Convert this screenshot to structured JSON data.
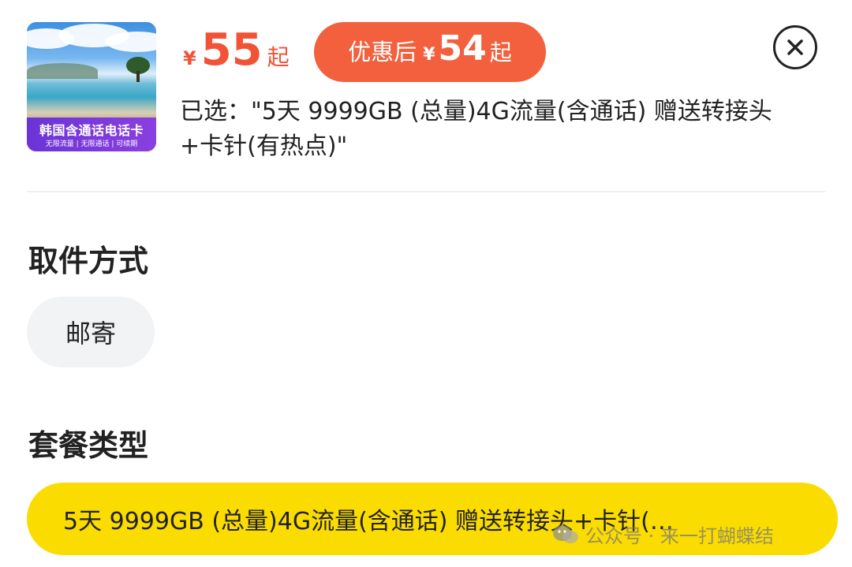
{
  "product": {
    "thumbnail_title": "韩国含通话电话卡",
    "thumbnail_tags": "无限流量 | 无限通话 | 可续期"
  },
  "price": {
    "currency": "¥",
    "amount": "55",
    "suffix": "起"
  },
  "promo": {
    "label": "优惠后",
    "currency": "¥",
    "amount": "54",
    "suffix": "起"
  },
  "selected_text": "已选：\"5天 9999GB (总量)4G流量(含通话) 赠送转接头+卡针(有热点)\"",
  "pickup": {
    "title": "取件方式",
    "options": [
      "邮寄"
    ]
  },
  "package": {
    "title": "套餐类型",
    "selected_option": "5天 9999GB (总量)4G流量(含通话) 赠送转接头+卡针(…"
  },
  "watermark": "公众号 · 来一打蝴蝶结",
  "colors": {
    "price": "#f25236",
    "promo_bg": "#f2603d",
    "selected_plan_bg": "#fbdc00",
    "chip_bg": "#f2f3f5"
  },
  "icons": {
    "close": "close-icon",
    "watermark": "wechat-icon"
  }
}
